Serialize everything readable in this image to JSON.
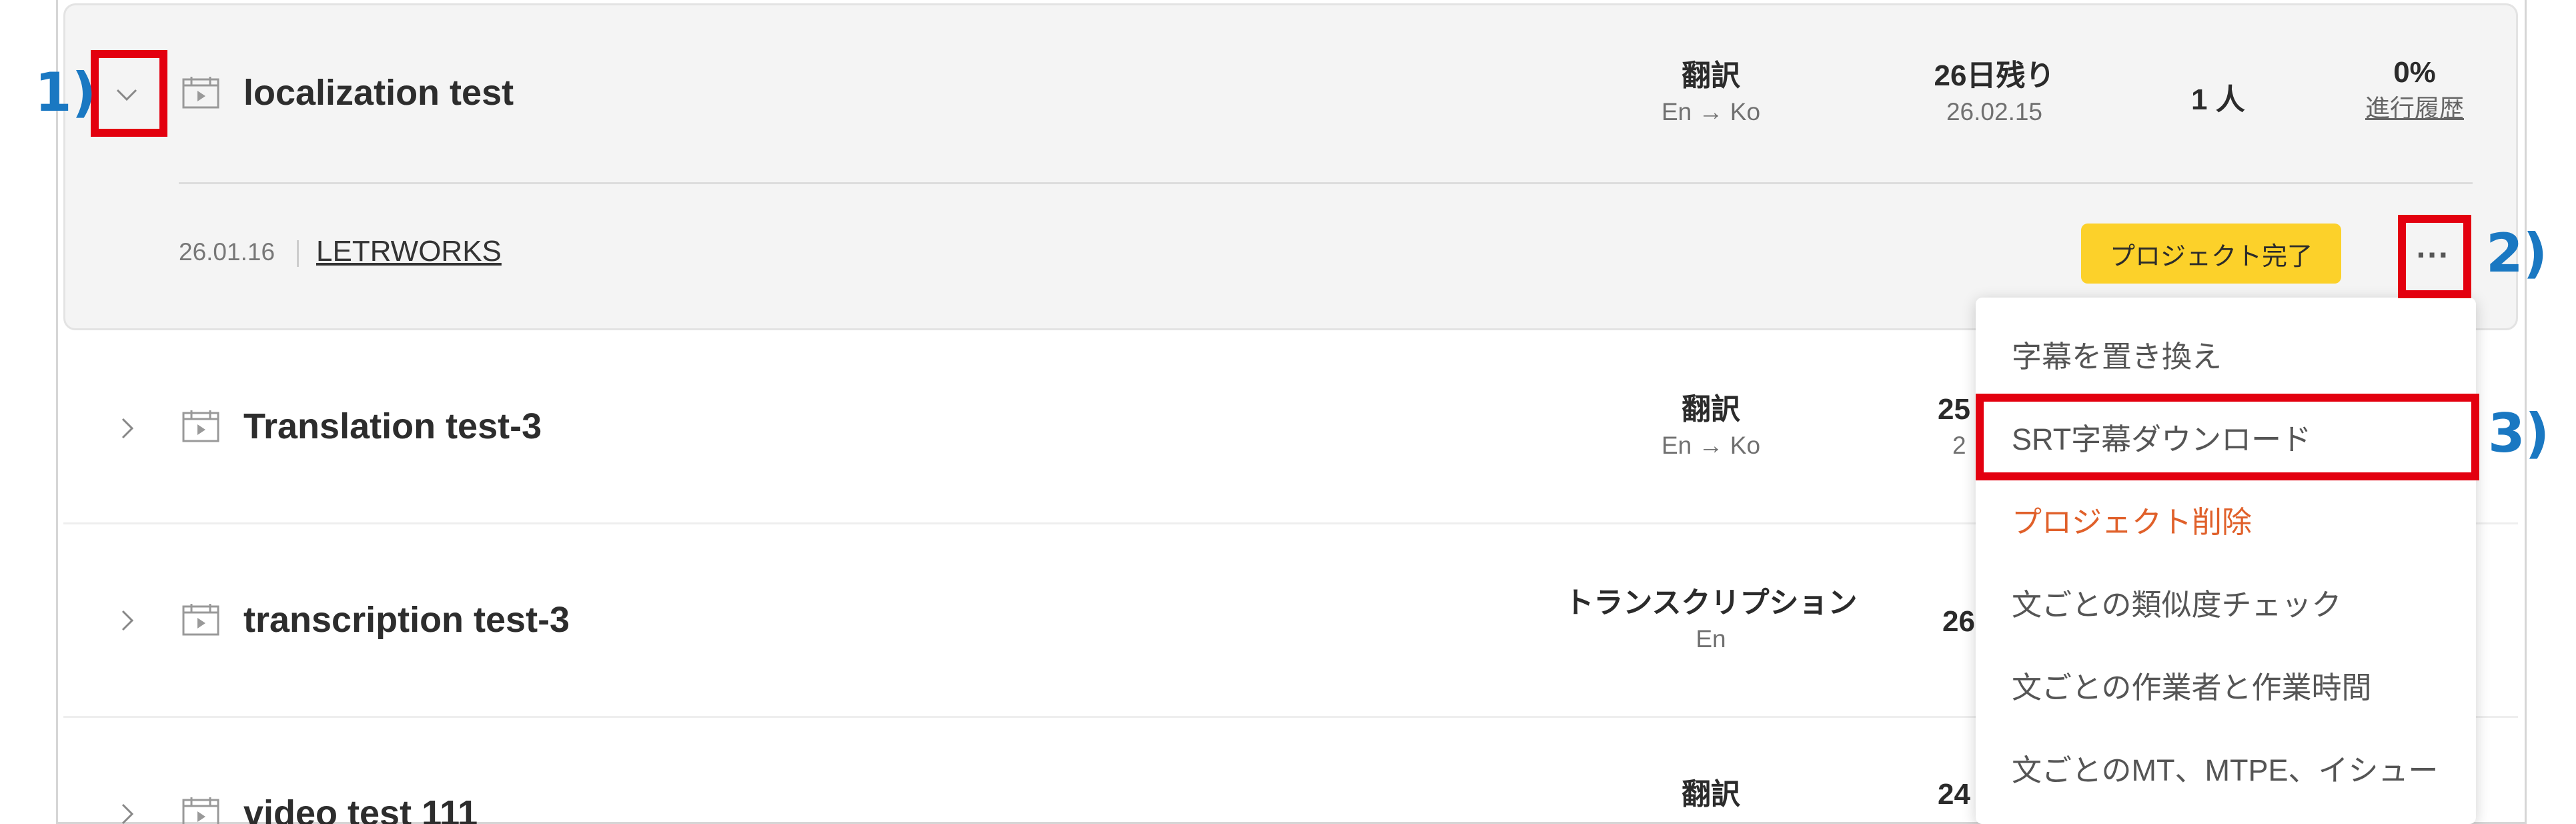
{
  "projects": [
    {
      "title": "localization test",
      "type": "翻訳",
      "lang": "En → Ko",
      "remaining": "26日残り",
      "due": "26.02.15",
      "people": "1 人",
      "progress": "0%",
      "history_link": "進行履歴",
      "created": "26.01.16",
      "client": "LETRWORKS",
      "complete_button": "プロジェクト完了",
      "more_button": "···"
    },
    {
      "title": "Translation test-3",
      "type": "翻訳",
      "lang": "En → Ko",
      "remaining": "25",
      "due": "2"
    },
    {
      "title": "transcription test-3",
      "type": "トランスクリプション",
      "lang": "En",
      "remaining": "26"
    },
    {
      "title": "video test 111",
      "type": "翻訳",
      "remaining": "24"
    }
  ],
  "menu": {
    "items": [
      "字幕を置き換え",
      "SRT字幕ダウンロード",
      "プロジェクト削除",
      "文ごとの類似度チェック",
      "文ごとの作業者と作業時間",
      "文ごとのMT、MTPE、イシュー"
    ]
  },
  "callouts": {
    "one": "1)",
    "two": "2)",
    "three": "3)"
  },
  "colors": {
    "highlight": "#e3000f",
    "callout": "#1a78c2",
    "accent_button": "#fcd12a",
    "danger": "#e0602a"
  }
}
